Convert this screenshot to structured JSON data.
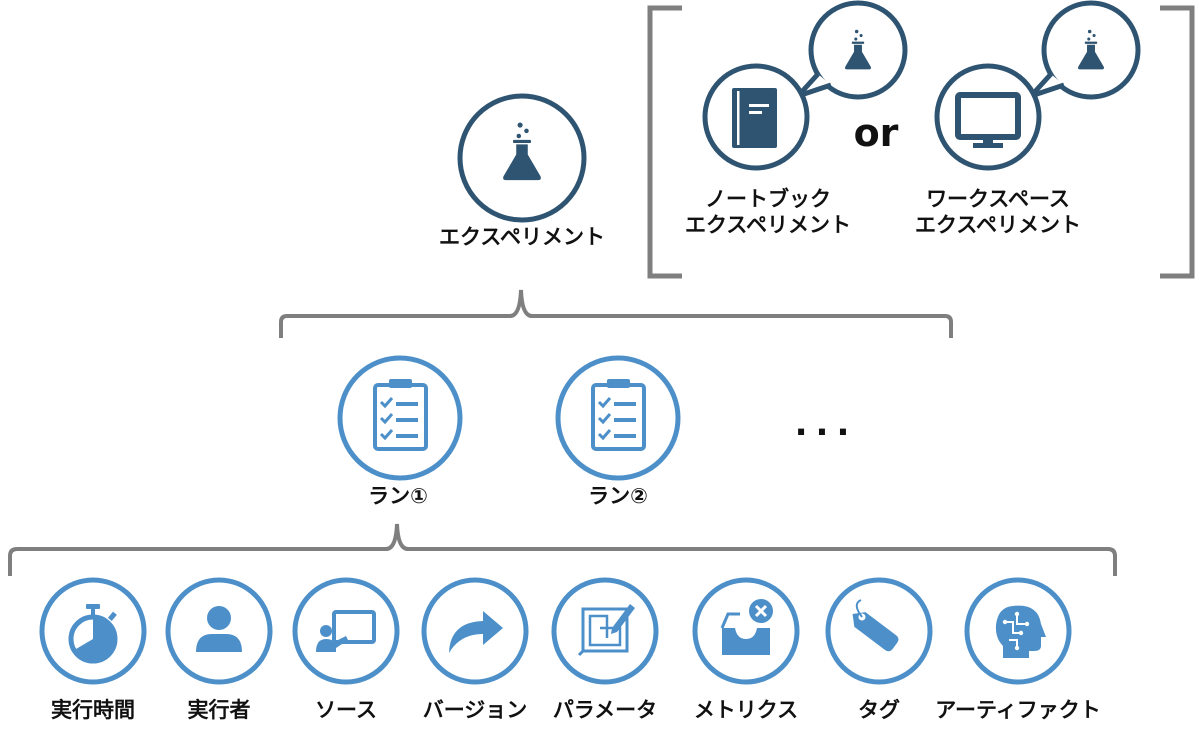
{
  "colors": {
    "dark": "#2e5471",
    "blue": "#4d90c9",
    "bracket": "#7f7f7f",
    "text": "#111111"
  },
  "experiment": {
    "icon": "flask-icon",
    "label": "エクスペリメント"
  },
  "variants": {
    "separator": "or",
    "items": [
      {
        "icon": "notebook-icon",
        "bubble_icon": "flask-icon",
        "label_line1": "ノートブック",
        "label_line2": "エクスペリメント"
      },
      {
        "icon": "monitor-icon",
        "bubble_icon": "flask-icon",
        "label_line1": "ワークスペース",
        "label_line2": "エクスペリメント"
      }
    ]
  },
  "runs": {
    "items": [
      {
        "icon": "clipboard-checklist-icon",
        "label": "ラン①"
      },
      {
        "icon": "clipboard-checklist-icon",
        "label": "ラン②"
      }
    ],
    "more": "..."
  },
  "attributes": [
    {
      "icon": "stopwatch-icon",
      "label": "実行時間"
    },
    {
      "icon": "person-icon",
      "label": "実行者"
    },
    {
      "icon": "presenter-board-icon",
      "label": "ソース"
    },
    {
      "icon": "curved-arrow-icon",
      "label": "バージョン"
    },
    {
      "icon": "blueprint-icon",
      "label": "パラメータ"
    },
    {
      "icon": "inbox-x-icon",
      "label": "メトリクス"
    },
    {
      "icon": "tag-icon",
      "label": "タグ"
    },
    {
      "icon": "ai-head-icon",
      "label": "アーティファクト"
    }
  ]
}
